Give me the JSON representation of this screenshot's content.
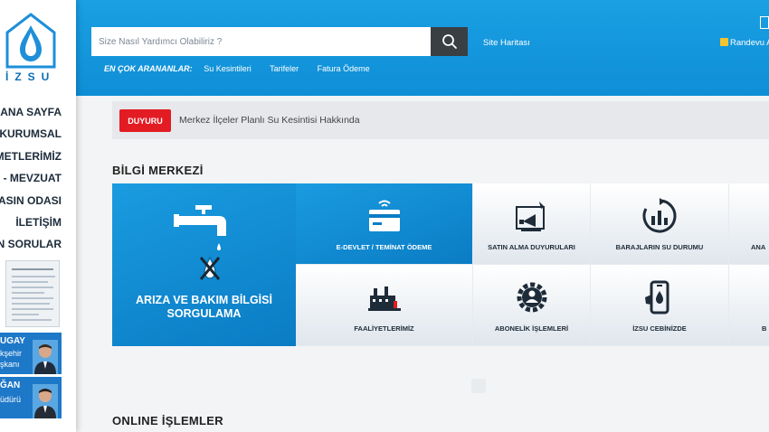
{
  "logo_text": "İZSU",
  "sidebar": {
    "nav": [
      "ANA SAYFA",
      "KURUMSAL",
      "METLERİMİZ",
      "- MEVZUAT",
      "ASIN ODASI",
      "İLETİŞİM",
      "N SORULAR"
    ],
    "people": [
      {
        "name": "UGAY",
        "role1": "kşehir",
        "role2": "şkanı"
      },
      {
        "name": "ĞAN",
        "role1": "üdürü"
      }
    ]
  },
  "header": {
    "search_placeholder": "Size Nasıl Yardımcı Olabiliriz ?",
    "site_map": "Site Haritası",
    "randevu": "Randevu A",
    "popular_label": "EN ÇOK ARANANLAR:",
    "popular_links": [
      "Su Kesintileri",
      "Tarifeler",
      "Fatura Ödeme"
    ]
  },
  "announcement": {
    "badge": "DUYURU",
    "text": "Merkez İlçeler Planlı Su Kesintisi Hakkında"
  },
  "info_center": {
    "title": "BİLGİ MERKEZİ",
    "big_tile": "ARIZA VE BAKIM BİLGİSİ SORGULAMA",
    "tiles": [
      "E-DEVLET / TEMİNAT ÖDEME",
      "SATIN ALMA DUYURULARI",
      "BARAJLARIN SU DURUMU",
      "ANA",
      "FAALİYETLERİMİZ",
      "ABONELİK İŞLEMLERİ",
      "İZSU CEBİNİZDE",
      "B"
    ]
  },
  "online_title": "ONLINE İŞLEMLER",
  "colors": {
    "header_blue": "#1aa0e3",
    "tile_blue": "#0a7cc4",
    "badge_red": "#e31b23",
    "search_button": "#3a3f44"
  }
}
